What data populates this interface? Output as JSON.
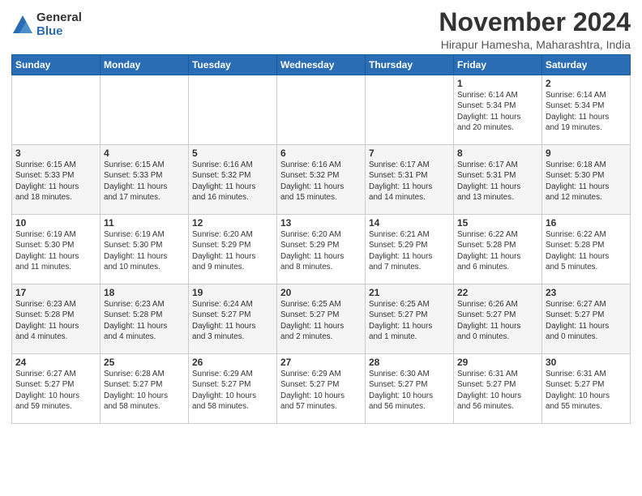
{
  "logo": {
    "general": "General",
    "blue": "Blue"
  },
  "title": "November 2024",
  "location": "Hirapur Hamesha, Maharashtra, India",
  "weekdays": [
    "Sunday",
    "Monday",
    "Tuesday",
    "Wednesday",
    "Thursday",
    "Friday",
    "Saturday"
  ],
  "weeks": [
    [
      {
        "day": "",
        "info": ""
      },
      {
        "day": "",
        "info": ""
      },
      {
        "day": "",
        "info": ""
      },
      {
        "day": "",
        "info": ""
      },
      {
        "day": "",
        "info": ""
      },
      {
        "day": "1",
        "info": "Sunrise: 6:14 AM\nSunset: 5:34 PM\nDaylight: 11 hours\nand 20 minutes."
      },
      {
        "day": "2",
        "info": "Sunrise: 6:14 AM\nSunset: 5:34 PM\nDaylight: 11 hours\nand 19 minutes."
      }
    ],
    [
      {
        "day": "3",
        "info": "Sunrise: 6:15 AM\nSunset: 5:33 PM\nDaylight: 11 hours\nand 18 minutes."
      },
      {
        "day": "4",
        "info": "Sunrise: 6:15 AM\nSunset: 5:33 PM\nDaylight: 11 hours\nand 17 minutes."
      },
      {
        "day": "5",
        "info": "Sunrise: 6:16 AM\nSunset: 5:32 PM\nDaylight: 11 hours\nand 16 minutes."
      },
      {
        "day": "6",
        "info": "Sunrise: 6:16 AM\nSunset: 5:32 PM\nDaylight: 11 hours\nand 15 minutes."
      },
      {
        "day": "7",
        "info": "Sunrise: 6:17 AM\nSunset: 5:31 PM\nDaylight: 11 hours\nand 14 minutes."
      },
      {
        "day": "8",
        "info": "Sunrise: 6:17 AM\nSunset: 5:31 PM\nDaylight: 11 hours\nand 13 minutes."
      },
      {
        "day": "9",
        "info": "Sunrise: 6:18 AM\nSunset: 5:30 PM\nDaylight: 11 hours\nand 12 minutes."
      }
    ],
    [
      {
        "day": "10",
        "info": "Sunrise: 6:19 AM\nSunset: 5:30 PM\nDaylight: 11 hours\nand 11 minutes."
      },
      {
        "day": "11",
        "info": "Sunrise: 6:19 AM\nSunset: 5:30 PM\nDaylight: 11 hours\nand 10 minutes."
      },
      {
        "day": "12",
        "info": "Sunrise: 6:20 AM\nSunset: 5:29 PM\nDaylight: 11 hours\nand 9 minutes."
      },
      {
        "day": "13",
        "info": "Sunrise: 6:20 AM\nSunset: 5:29 PM\nDaylight: 11 hours\nand 8 minutes."
      },
      {
        "day": "14",
        "info": "Sunrise: 6:21 AM\nSunset: 5:29 PM\nDaylight: 11 hours\nand 7 minutes."
      },
      {
        "day": "15",
        "info": "Sunrise: 6:22 AM\nSunset: 5:28 PM\nDaylight: 11 hours\nand 6 minutes."
      },
      {
        "day": "16",
        "info": "Sunrise: 6:22 AM\nSunset: 5:28 PM\nDaylight: 11 hours\nand 5 minutes."
      }
    ],
    [
      {
        "day": "17",
        "info": "Sunrise: 6:23 AM\nSunset: 5:28 PM\nDaylight: 11 hours\nand 4 minutes."
      },
      {
        "day": "18",
        "info": "Sunrise: 6:23 AM\nSunset: 5:28 PM\nDaylight: 11 hours\nand 4 minutes."
      },
      {
        "day": "19",
        "info": "Sunrise: 6:24 AM\nSunset: 5:27 PM\nDaylight: 11 hours\nand 3 minutes."
      },
      {
        "day": "20",
        "info": "Sunrise: 6:25 AM\nSunset: 5:27 PM\nDaylight: 11 hours\nand 2 minutes."
      },
      {
        "day": "21",
        "info": "Sunrise: 6:25 AM\nSunset: 5:27 PM\nDaylight: 11 hours\nand 1 minute."
      },
      {
        "day": "22",
        "info": "Sunrise: 6:26 AM\nSunset: 5:27 PM\nDaylight: 11 hours\nand 0 minutes."
      },
      {
        "day": "23",
        "info": "Sunrise: 6:27 AM\nSunset: 5:27 PM\nDaylight: 11 hours\nand 0 minutes."
      }
    ],
    [
      {
        "day": "24",
        "info": "Sunrise: 6:27 AM\nSunset: 5:27 PM\nDaylight: 10 hours\nand 59 minutes."
      },
      {
        "day": "25",
        "info": "Sunrise: 6:28 AM\nSunset: 5:27 PM\nDaylight: 10 hours\nand 58 minutes."
      },
      {
        "day": "26",
        "info": "Sunrise: 6:29 AM\nSunset: 5:27 PM\nDaylight: 10 hours\nand 58 minutes."
      },
      {
        "day": "27",
        "info": "Sunrise: 6:29 AM\nSunset: 5:27 PM\nDaylight: 10 hours\nand 57 minutes."
      },
      {
        "day": "28",
        "info": "Sunrise: 6:30 AM\nSunset: 5:27 PM\nDaylight: 10 hours\nand 56 minutes."
      },
      {
        "day": "29",
        "info": "Sunrise: 6:31 AM\nSunset: 5:27 PM\nDaylight: 10 hours\nand 56 minutes."
      },
      {
        "day": "30",
        "info": "Sunrise: 6:31 AM\nSunset: 5:27 PM\nDaylight: 10 hours\nand 55 minutes."
      }
    ]
  ]
}
